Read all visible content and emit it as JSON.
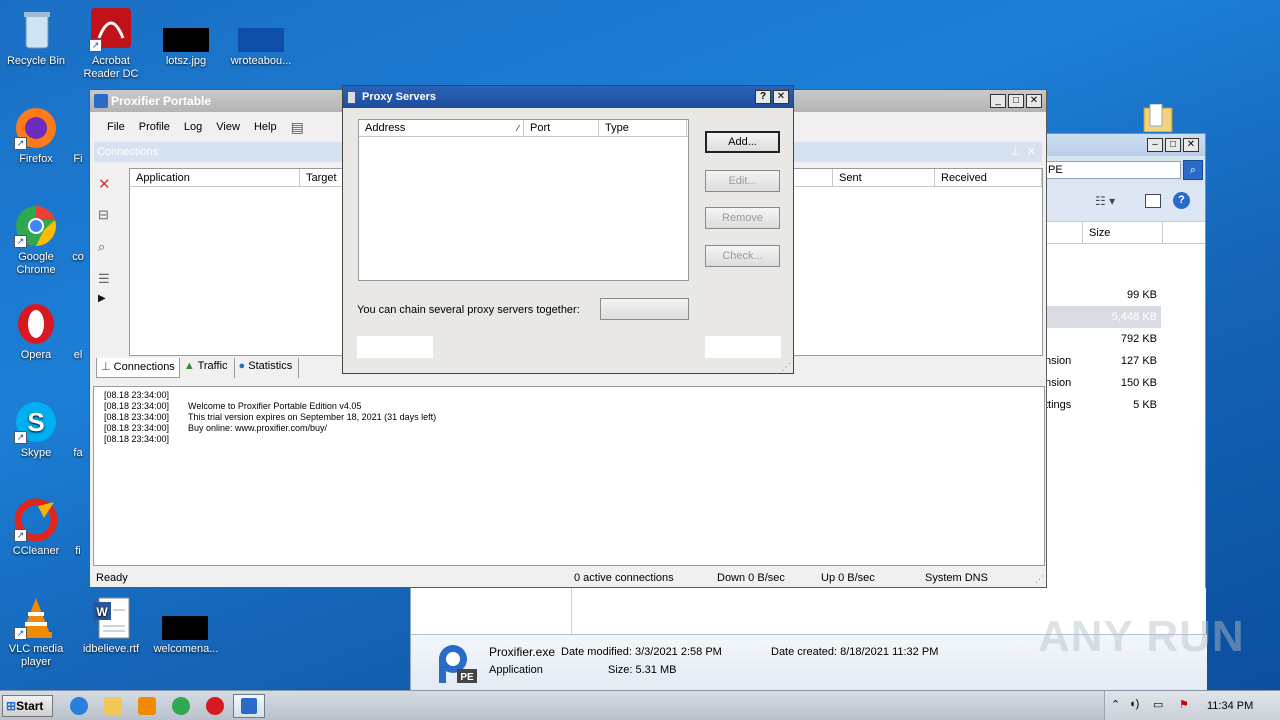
{
  "desktop": {
    "icons": [
      {
        "label": "Recycle Bin"
      },
      {
        "label": "Acrobat Reader DC"
      },
      {
        "label": "lotsz.jpg"
      },
      {
        "label": "wroteabou..."
      },
      {
        "label": "Firefox"
      },
      {
        "label": "Fi"
      },
      {
        "label": "Google Chrome"
      },
      {
        "label": "co"
      },
      {
        "label": "Opera"
      },
      {
        "label": "el"
      },
      {
        "label": "Skype"
      },
      {
        "label": "fa"
      },
      {
        "label": "CCleaner"
      },
      {
        "label": "fi"
      },
      {
        "label": "VLC media player"
      },
      {
        "label": "idbelieve.rtf"
      },
      {
        "label": "welcomena..."
      }
    ]
  },
  "proxifier": {
    "title": "Proxifier Portable",
    "menu": [
      "File",
      "Profile",
      "Log",
      "View",
      "Help"
    ],
    "connections_label": "Connections",
    "columns": [
      "Application",
      "Target",
      "Sent",
      "Received"
    ],
    "tabs": [
      "Connections",
      "Traffic",
      "Statistics"
    ],
    "log": [
      {
        "time": "[08.18 23:34:00]",
        "msg": ""
      },
      {
        "time": "[08.18 23:34:00]",
        "msg": "Welcome to Proxifier Portable Edition v4.05"
      },
      {
        "time": "[08.18 23:34:00]",
        "msg": "This trial version expires on September 18, 2021 (31 days left)"
      },
      {
        "time": "[08.18 23:34:00]",
        "msg": "Buy online: www.proxifier.com/buy/"
      },
      {
        "time": "[08.18 23:34:00]",
        "msg": ""
      }
    ],
    "status": {
      "ready": "Ready",
      "active": "0 active connections",
      "down": "Down 0 B/sec",
      "up": "Up 0 B/sec",
      "dns": "System DNS"
    }
  },
  "proxy_dialog": {
    "title": "Proxy Servers",
    "help_btn": "?",
    "columns": [
      "Address",
      "Port",
      "Type"
    ],
    "buttons": {
      "add": "Add...",
      "edit": "Edit...",
      "remove": "Remove",
      "check": "Check..."
    },
    "chain_label": "You can chain several proxy servers together:"
  },
  "explorer": {
    "search_value": "PE",
    "size_header": "Size",
    "rows": [
      {
        "name": "",
        "size": "99 KB"
      },
      {
        "name": "",
        "size": "5,448 KB"
      },
      {
        "name": "",
        "size": "792 KB"
      },
      {
        "name": "nsion",
        "size": "127 KB"
      },
      {
        "name": "nsion",
        "size": "150 KB"
      },
      {
        "name": "ttings",
        "size": "5 KB"
      }
    ],
    "details": {
      "filename": "Proxifier.exe",
      "date_modified": "Date modified: 3/3/2021 2:58 PM",
      "date_created": "Date created: 8/18/2021 11:32 PM",
      "type": "Application",
      "size": "Size: 5.31 MB"
    }
  },
  "taskbar": {
    "start": "Start",
    "time": "11:34 PM"
  },
  "watermark": "ANY RUN"
}
